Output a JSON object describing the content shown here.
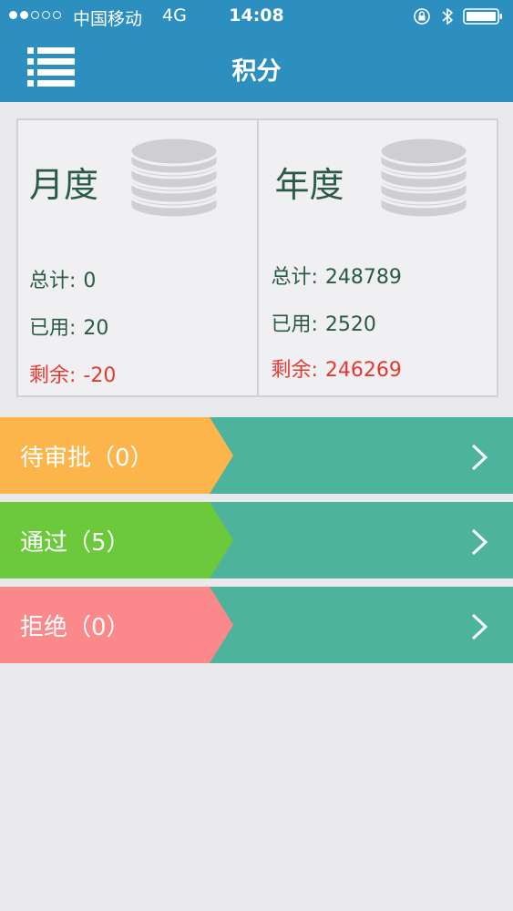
{
  "status_bar": {
    "carrier": "中国移动",
    "network": "4G",
    "time": "14:08"
  },
  "nav": {
    "title": "积分"
  },
  "cards": {
    "monthly": {
      "title": "月度",
      "total_label": "总计:",
      "total_value": "0",
      "used_label": "已用:",
      "used_value": "20",
      "remaining_label": "剩余:",
      "remaining_value": "-20"
    },
    "yearly": {
      "title": "年度",
      "total_label": "总计:",
      "total_value": "248789",
      "used_label": "已用:",
      "used_value": "2520",
      "remaining_label": "剩余:",
      "remaining_value": "246269"
    }
  },
  "rows": [
    {
      "label": "待审批（0）",
      "color": "#fbb54a"
    },
    {
      "label": "通过（5）",
      "color": "#6bc93b"
    },
    {
      "label": "拒绝（0）",
      "color": "#fb888a"
    }
  ],
  "colors": {
    "header": "#2c8fc0",
    "row_background": "#4eb39d",
    "remaining": "#e03a33"
  }
}
